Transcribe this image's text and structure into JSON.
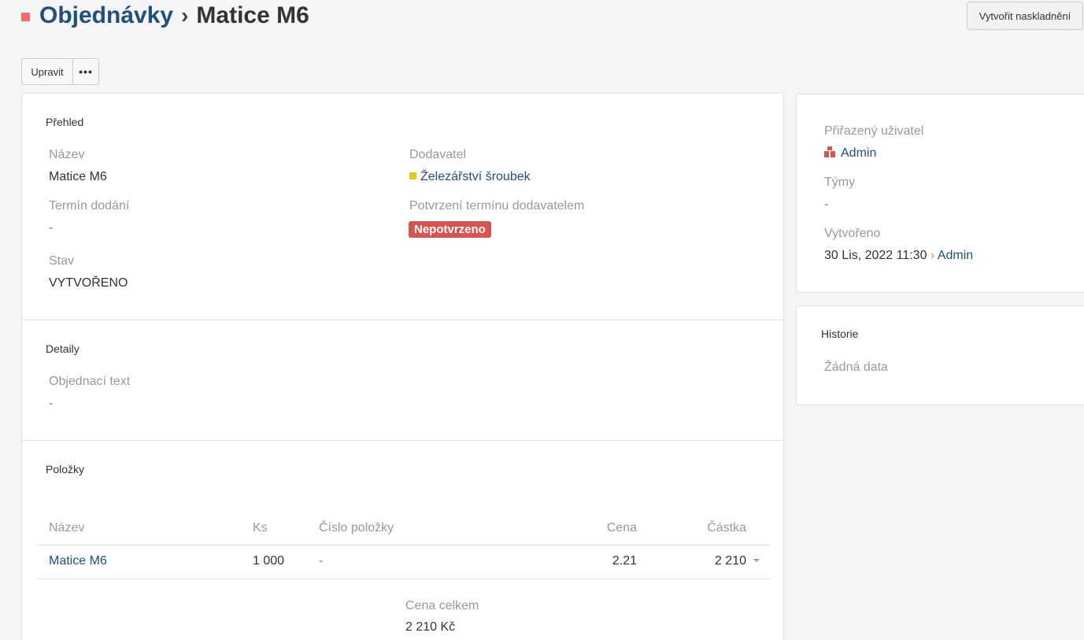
{
  "header": {
    "breadcrumb": "Objednávky",
    "separator": "›",
    "title": "Matice M6"
  },
  "actions": {
    "create_stock_in": "Vytvořit naskladnění",
    "edit": "Upravit",
    "more": "•••"
  },
  "overview": {
    "title": "Přehled",
    "name_label": "Název",
    "name_value": "Matice M6",
    "supplier_label": "Dodavatel",
    "supplier_value": "Železářství šroubek",
    "delivery_label": "Termín dodání",
    "delivery_value": "-",
    "confirm_label": "Potvrzení termínu dodavatelem",
    "confirm_value": "Nepotvrzeno",
    "state_label": "Stav",
    "state_value": "VYTVOŘENO"
  },
  "details": {
    "title": "Detaily",
    "order_text_label": "Objednací text",
    "order_text_value": "-"
  },
  "items": {
    "title": "Položky",
    "columns": [
      "Název",
      "Ks",
      "Číslo položky",
      "Cena",
      "Částka"
    ],
    "rows": [
      {
        "name": "Matice M6",
        "qty": "1 000",
        "item_no": "-",
        "price": "2.21",
        "amount": "2 210"
      }
    ],
    "total_label": "Cena celkem",
    "total_value": "2 210 Kč"
  },
  "sidebar": {
    "assigned_label": "Přiřazený uživatel",
    "assigned_value": "Admin",
    "teams_label": "Týmy",
    "teams_value": "-",
    "created_label": "Vytvořeno",
    "created_value": "30 Lis, 2022 11:30",
    "created_sep": "›",
    "created_by": "Admin",
    "history_title": "Historie",
    "history_empty": "Žádná data"
  },
  "colors": {
    "link": "#1f4f7d",
    "badge_danger": "#d9534f",
    "supplier_square": "#e8c51a",
    "header_square": "#f46b6b"
  }
}
